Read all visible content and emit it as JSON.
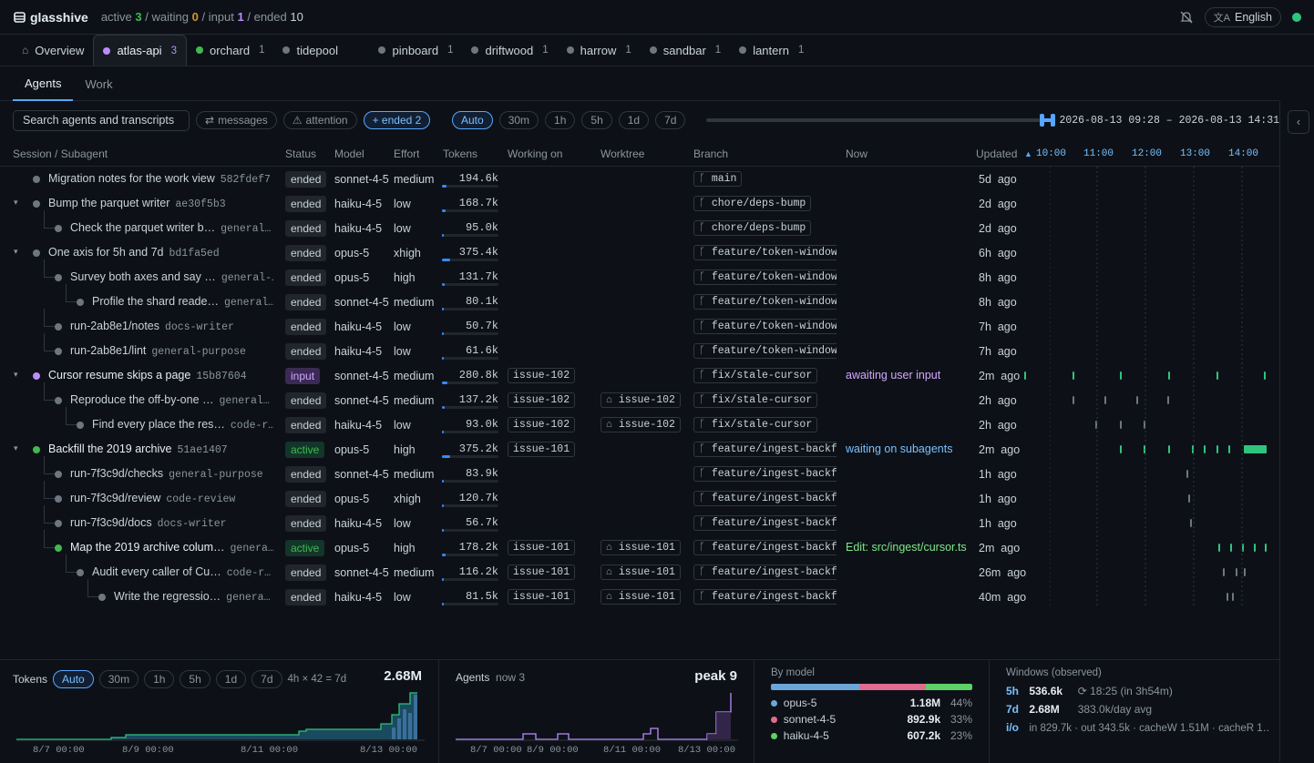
{
  "app": {
    "name": "glasshive",
    "counts": {
      "active_label": "active",
      "active": "3",
      "waiting_label": "/ waiting",
      "waiting": "0",
      "input_label": "/ input",
      "input": "1",
      "ended_label": "/ ended",
      "ended": "10"
    },
    "language": "English"
  },
  "tabs": [
    {
      "label": "Overview",
      "count": ""
    },
    {
      "label": "atlas-api",
      "count": "3"
    },
    {
      "label": "orchard",
      "count": "1"
    },
    {
      "label": "tidepool",
      "count": ""
    },
    {
      "label": "pinboard",
      "count": "1"
    },
    {
      "label": "driftwood",
      "count": "1"
    },
    {
      "label": "harrow",
      "count": "1"
    },
    {
      "label": "sandbar",
      "count": "1"
    },
    {
      "label": "lantern",
      "count": "1"
    }
  ],
  "subtabs": [
    "Agents",
    "Work"
  ],
  "filters": {
    "search_placeholder": "Search agents and transcripts",
    "messages": "messages",
    "attention": "attention",
    "ended": "+ ended 2",
    "ranges": [
      "Auto",
      "30m",
      "1h",
      "5h",
      "1d",
      "7d"
    ],
    "range_start": "2026-08-13 09:28",
    "range_sep": "–",
    "range_end": "2026-08-13 14:31"
  },
  "columns": {
    "session": "Session / Subagent",
    "status": "Status",
    "model": "Model",
    "effort": "Effort",
    "tokens": "Tokens",
    "working": "Working on",
    "worktree": "Worktree",
    "branch": "Branch",
    "now": "Now",
    "updated": "Updated"
  },
  "gantt_ticks": [
    "10:00",
    "11:00",
    "12:00",
    "13:00",
    "14:00"
  ],
  "rows": [
    {
      "name": "Migration notes for the work view",
      "sub": "582fdef7",
      "status": "ended",
      "model": "sonnet-4-5",
      "effort": "medium",
      "tokens": "194.6k",
      "fill": 0.08,
      "working": "",
      "worktree": "",
      "branch": "main",
      "now": "",
      "updated": "5d  ago"
    },
    {
      "name": "Bump the parquet writer",
      "sub": "ae30f5b3",
      "status": "ended",
      "model": "haiku-4-5",
      "effort": "low",
      "tokens": "168.7k",
      "fill": 0.07,
      "working": "",
      "worktree": "",
      "branch": "chore/deps-bump",
      "now": "",
      "updated": "2d  ago"
    },
    {
      "name": "Check the parquet writer b…",
      "sub": "general…",
      "status": "ended",
      "model": "haiku-4-5",
      "effort": "low",
      "tokens": "95.0k",
      "fill": 0.04,
      "working": "",
      "worktree": "",
      "branch": "chore/deps-bump",
      "now": "",
      "updated": "2d  ago"
    },
    {
      "name": "One axis for 5h and 7d",
      "sub": "bd1fa5ed",
      "status": "ended",
      "model": "opus-5",
      "effort": "xhigh",
      "tokens": "375.4k",
      "fill": 0.14,
      "working": "",
      "worktree": "",
      "branch": "feature/token-window",
      "now": "",
      "updated": "6h  ago"
    },
    {
      "name": "Survey both axes and say …",
      "sub": "general-…",
      "status": "ended",
      "model": "opus-5",
      "effort": "high",
      "tokens": "131.7k",
      "fill": 0.05,
      "working": "",
      "worktree": "",
      "branch": "feature/token-window",
      "now": "",
      "updated": "8h  ago"
    },
    {
      "name": "Profile the shard reade…",
      "sub": "general…",
      "status": "ended",
      "model": "sonnet-4-5",
      "effort": "medium",
      "tokens": "80.1k",
      "fill": 0.03,
      "working": "",
      "worktree": "",
      "branch": "feature/token-window",
      "now": "",
      "updated": "8h  ago"
    },
    {
      "name": "run-2ab8e1/notes",
      "sub": "docs-writer",
      "status": "ended",
      "model": "haiku-4-5",
      "effort": "low",
      "tokens": "50.7k",
      "fill": 0.02,
      "working": "",
      "worktree": "",
      "branch": "feature/token-window",
      "now": "",
      "updated": "7h  ago"
    },
    {
      "name": "run-2ab8e1/lint",
      "sub": "general-purpose",
      "status": "ended",
      "model": "haiku-4-5",
      "effort": "low",
      "tokens": "61.6k",
      "fill": 0.02,
      "working": "",
      "worktree": "",
      "branch": "feature/token-window",
      "now": "",
      "updated": "7h  ago"
    },
    {
      "name": "Cursor resume skips a page",
      "sub": "15b87604",
      "status": "input",
      "model": "sonnet-4-5",
      "effort": "medium",
      "tokens": "280.8k",
      "fill": 0.1,
      "working": "issue-102",
      "worktree": "",
      "branch": "fix/stale-cursor",
      "now": "awaiting user input",
      "updated": "2m  ago"
    },
    {
      "name": "Reproduce the off-by-one …",
      "sub": "general…",
      "status": "ended",
      "model": "sonnet-4-5",
      "effort": "medium",
      "tokens": "137.2k",
      "fill": 0.05,
      "working": "issue-102",
      "worktree": "issue-102",
      "branch": "fix/stale-cursor",
      "now": "",
      "updated": "2h  ago"
    },
    {
      "name": "Find every place the res…",
      "sub": "code-r…",
      "status": "ended",
      "model": "haiku-4-5",
      "effort": "low",
      "tokens": "93.0k",
      "fill": 0.03,
      "working": "issue-102",
      "worktree": "issue-102",
      "branch": "fix/stale-cursor",
      "now": "",
      "updated": "2h  ago"
    },
    {
      "name": "Backfill the 2019 archive",
      "sub": "51ae1407",
      "status": "active",
      "model": "opus-5",
      "effort": "high",
      "tokens": "375.2k",
      "fill": 0.14,
      "working": "issue-101",
      "worktree": "",
      "branch": "feature/ingest-backfil",
      "now": "waiting on subagents",
      "updated": "2m  ago"
    },
    {
      "name": "run-7f3c9d/checks",
      "sub": "general-purpose",
      "status": "ended",
      "model": "sonnet-4-5",
      "effort": "medium",
      "tokens": "83.9k",
      "fill": 0.03,
      "working": "",
      "worktree": "",
      "branch": "feature/ingest-backfil",
      "now": "",
      "updated": "1h  ago"
    },
    {
      "name": "run-7f3c9d/review",
      "sub": "code-review",
      "status": "ended",
      "model": "opus-5",
      "effort": "xhigh",
      "tokens": "120.7k",
      "fill": 0.04,
      "working": "",
      "worktree": "",
      "branch": "feature/ingest-backfil",
      "now": "",
      "updated": "1h  ago"
    },
    {
      "name": "run-7f3c9d/docs",
      "sub": "docs-writer",
      "status": "ended",
      "model": "haiku-4-5",
      "effort": "low",
      "tokens": "56.7k",
      "fill": 0.02,
      "working": "",
      "worktree": "",
      "branch": "feature/ingest-backfil",
      "now": "",
      "updated": "1h  ago"
    },
    {
      "name": "Map the 2019 archive colum…",
      "sub": "genera…",
      "status": "active",
      "model": "opus-5",
      "effort": "high",
      "tokens": "178.2k",
      "fill": 0.07,
      "working": "issue-101",
      "worktree": "issue-101",
      "branch": "feature/ingest-backfil",
      "now": "Edit: src/ingest/cursor.ts",
      "updated": "2m  ago"
    },
    {
      "name": "Audit every caller of Cu…",
      "sub": "code-r…",
      "status": "ended",
      "model": "sonnet-4-5",
      "effort": "medium",
      "tokens": "116.2k",
      "fill": 0.04,
      "working": "issue-101",
      "worktree": "issue-101",
      "branch": "feature/ingest-backfil",
      "now": "",
      "updated": "26m  ago"
    },
    {
      "name": "Write the regressio…",
      "sub": "genera…",
      "status": "ended",
      "model": "haiku-4-5",
      "effort": "low",
      "tokens": "81.5k",
      "fill": 0.03,
      "working": "issue-101",
      "worktree": "issue-101",
      "branch": "feature/ingest-backfil",
      "now": "",
      "updated": "40m  ago"
    }
  ],
  "tokens_panel": {
    "title": "Tokens",
    "ranges": [
      "Auto",
      "30m",
      "1h",
      "5h",
      "1d",
      "7d"
    ],
    "window": "4h × 42 = 7d",
    "total": "2.68M",
    "x_ticks": [
      "8/7 00:00",
      "8/9 00:00",
      "8/11 00:00",
      "8/13 00:00"
    ]
  },
  "agents_panel": {
    "title": "Agents",
    "now": "now 3",
    "peak": "peak 9",
    "x_ticks": [
      "8/7 00:00",
      "8/9 00:00",
      "8/11 00:00",
      "8/13 00:00"
    ]
  },
  "by_model": {
    "title": "By model",
    "items": [
      {
        "name": "opus-5",
        "value": "1.18M",
        "pct": "44%",
        "share": 0.44,
        "color": "#6ca6d9"
      },
      {
        "name": "sonnet-4-5",
        "value": "892.9k",
        "pct": "33%",
        "share": 0.33,
        "color": "#e06c8f"
      },
      {
        "name": "haiku-4-5",
        "value": "607.2k",
        "pct": "23%",
        "share": 0.23,
        "color": "#5fd068"
      }
    ]
  },
  "windows": {
    "title": "Windows (observed)",
    "w5h": {
      "key": "5h",
      "value": "536.6k",
      "extra": "18:25 (in 3h54m)"
    },
    "w7d": {
      "key": "7d",
      "value": "2.68M",
      "extra": "383.0k/day avg"
    },
    "io": {
      "key": "i/o",
      "extra": "in 829.7k · out 343.5k · cacheW 1.51M · cacheR 1…"
    }
  },
  "chart_data": [
    {
      "type": "area",
      "title": "Tokens",
      "x_ticks": [
        "8/7 00:00",
        "8/9 00:00",
        "8/11 00:00",
        "8/13 00:00"
      ],
      "total": "2.68M"
    },
    {
      "type": "line",
      "title": "Agents",
      "x_ticks": [
        "8/7 00:00",
        "8/9 00:00",
        "8/11 00:00",
        "8/13 00:00"
      ],
      "peak": 9,
      "now": 3
    }
  ],
  "colors": {
    "accent": "#58a6ff",
    "active": "#3fb950",
    "input": "#bc8cff",
    "waiting": "#d29922"
  }
}
